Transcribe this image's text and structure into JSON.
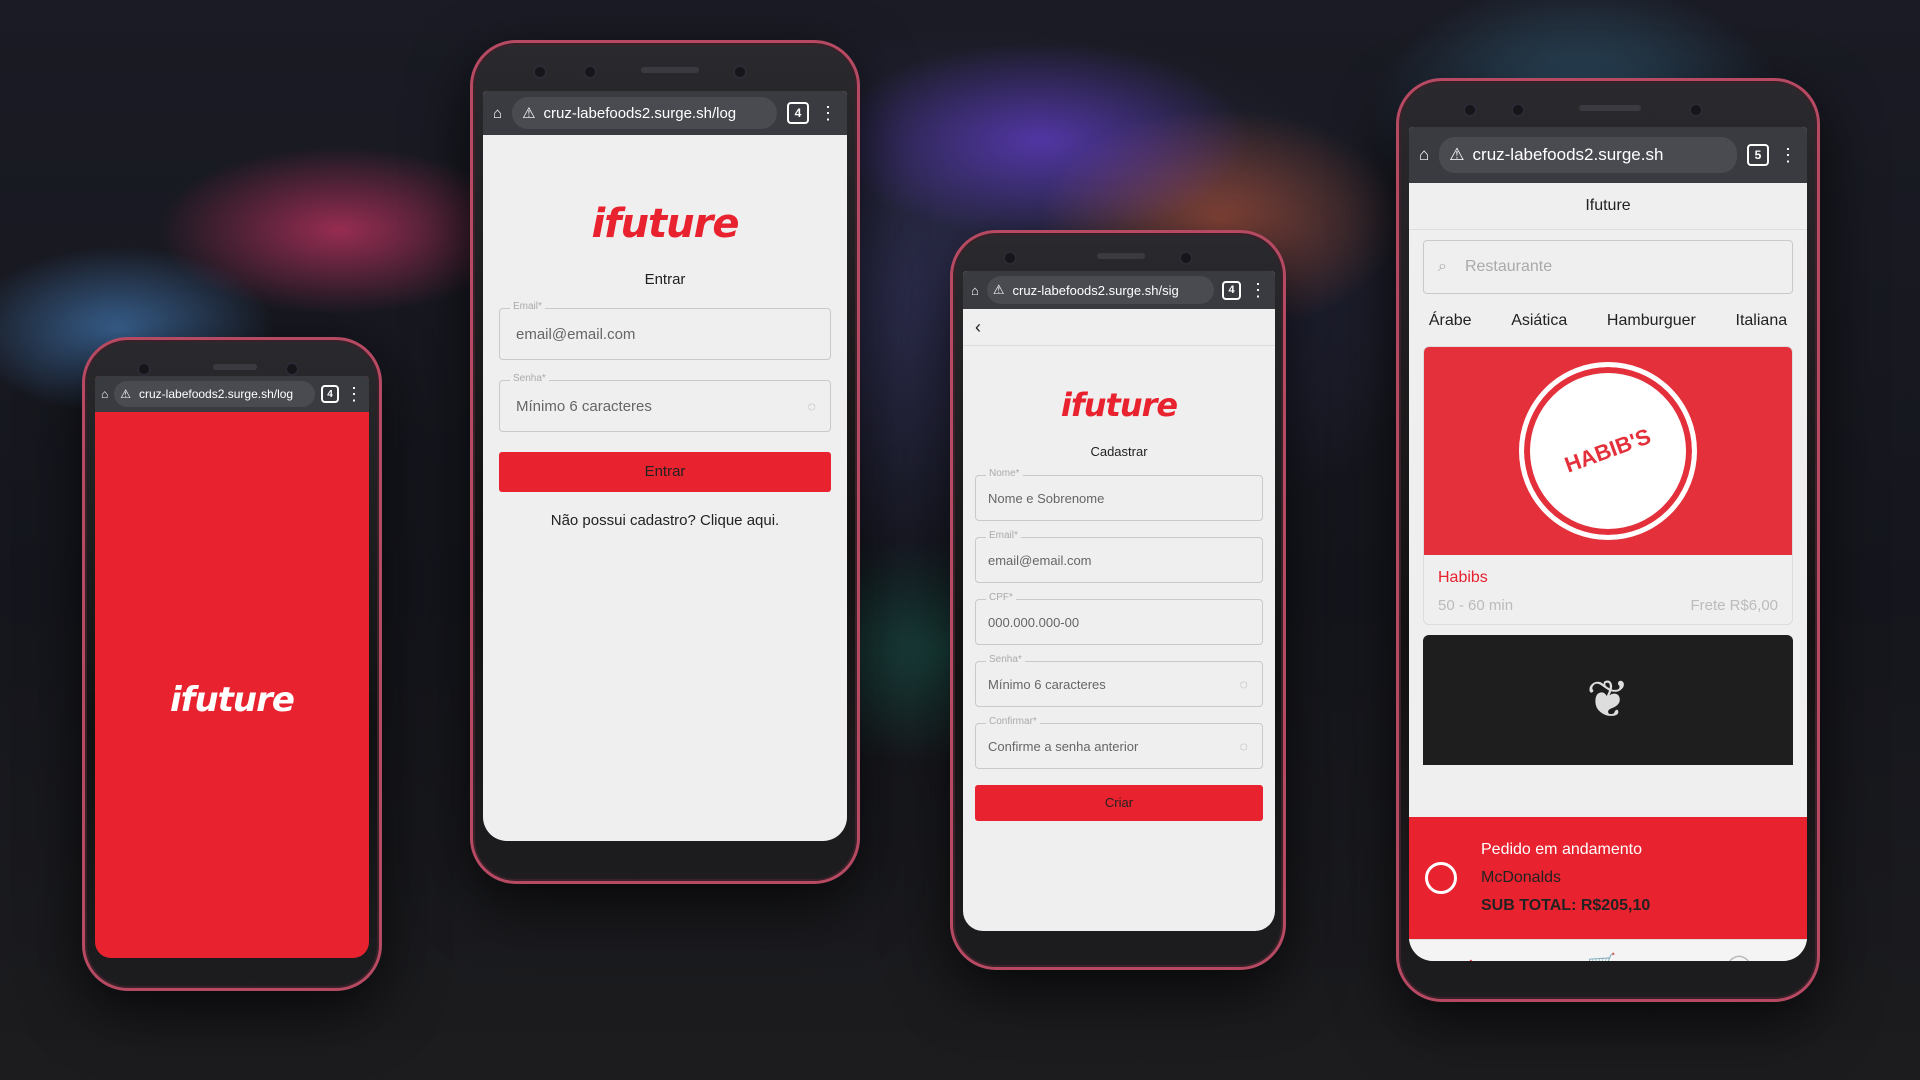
{
  "url_login": "cruz-labefoods2.surge.sh/log",
  "url_splash": "cruz-labefoods2.surge.sh/log",
  "url_signup": "cruz-labefoods2.surge.sh/sig",
  "url_home": "cruz-labefoods2.surge.sh",
  "tabs_login": "4",
  "tabs_splash": "4",
  "tabs_signup": "4",
  "tabs_home": "5",
  "logo_text": "ifuture",
  "login": {
    "title": "Entrar",
    "email_label": "Email*",
    "email_placeholder": "email@email.com",
    "password_label": "Senha*",
    "password_placeholder": "Mínimo 6 caracteres",
    "submit": "Entrar",
    "signup_link": "Não possui cadastro? Clique aqui."
  },
  "signup": {
    "title": "Cadastrar",
    "name_label": "Nome*",
    "name_placeholder": "Nome e Sobrenome",
    "email_label": "Email*",
    "email_placeholder": "email@email.com",
    "cpf_label": "CPF*",
    "cpf_placeholder": "000.000.000-00",
    "password_label": "Senha*",
    "password_placeholder": "Mínimo 6 caracteres",
    "confirm_label": "Confirmar*",
    "confirm_placeholder": "Confirme a senha anterior",
    "submit": "Criar"
  },
  "home": {
    "header": "Ifuture",
    "search_placeholder": "Restaurante",
    "categories": [
      "Árabe",
      "Asiática",
      "Hamburguer",
      "Italiana"
    ],
    "restaurant_name": "Habibs",
    "restaurant_time": "50 - 60 min",
    "restaurant_shipping": "Frete R$6,00",
    "restaurant_logo_text": "HABIB'S",
    "order_title": "Pedido em andamento",
    "order_restaurant": "McDonalds",
    "order_subtotal": "SUB TOTAL: R$205,10"
  },
  "colors": {
    "brand_red": "#e8222e",
    "phone_rim": "#b64a62"
  }
}
